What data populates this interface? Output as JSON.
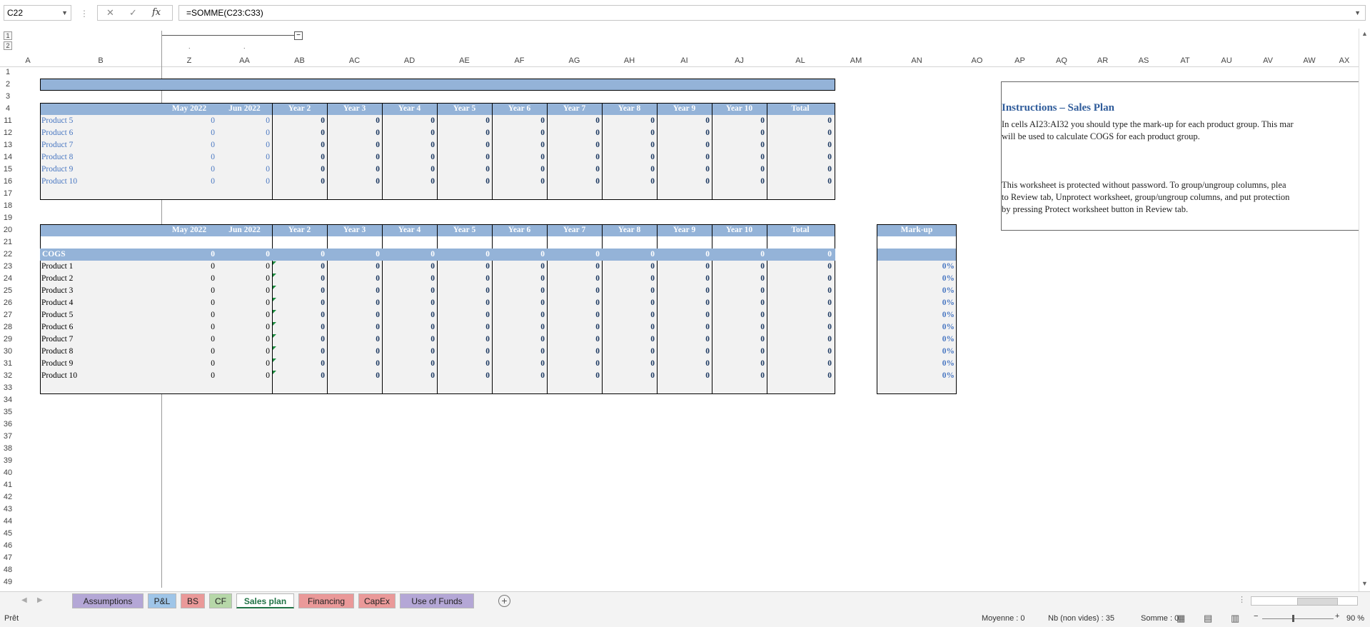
{
  "formula_bar": {
    "name_box": "C22",
    "cancel_icon": "✕",
    "enter_icon": "✓",
    "fx_label": "fx",
    "formula": "=SOMME(C23:C33)"
  },
  "outline": {
    "level1": "1",
    "level2": "2",
    "collapse": "−"
  },
  "columns": [
    "A",
    "B",
    "Z",
    "AA",
    "AB",
    "AC",
    "AD",
    "AE",
    "AF",
    "AG",
    "AH",
    "AI",
    "AJ",
    "AL",
    "AM",
    "AN",
    "AO",
    "AP",
    "AQ",
    "AR",
    "AS",
    "AT",
    "AU",
    "AV",
    "AW",
    "AX"
  ],
  "rows": [
    "1",
    "2",
    "3",
    "4",
    "11",
    "12",
    "13",
    "14",
    "15",
    "16",
    "17",
    "18",
    "19",
    "20",
    "21",
    "22",
    "23",
    "24",
    "25",
    "26",
    "27",
    "28",
    "29",
    "30",
    "31",
    "32",
    "33",
    "34",
    "35",
    "36",
    "37",
    "38",
    "39",
    "40",
    "41",
    "42",
    "43",
    "44",
    "45",
    "46",
    "47",
    "48",
    "49"
  ],
  "table1": {
    "headers": [
      "May 2022",
      "Jun 2022",
      "Year 2",
      "Year 3",
      "Year 4",
      "Year 5",
      "Year 6",
      "Year 7",
      "Year 8",
      "Year 9",
      "Year 10",
      "Total"
    ],
    "rows": [
      {
        "label": "Product 5",
        "values": [
          "0",
          "0",
          "0",
          "0",
          "0",
          "0",
          "0",
          "0",
          "0",
          "0",
          "0",
          "0"
        ]
      },
      {
        "label": "Product 6",
        "values": [
          "0",
          "0",
          "0",
          "0",
          "0",
          "0",
          "0",
          "0",
          "0",
          "0",
          "0",
          "0"
        ]
      },
      {
        "label": "Product 7",
        "values": [
          "0",
          "0",
          "0",
          "0",
          "0",
          "0",
          "0",
          "0",
          "0",
          "0",
          "0",
          "0"
        ]
      },
      {
        "label": "Product 8",
        "values": [
          "0",
          "0",
          "0",
          "0",
          "0",
          "0",
          "0",
          "0",
          "0",
          "0",
          "0",
          "0"
        ]
      },
      {
        "label": "Product 9",
        "values": [
          "0",
          "0",
          "0",
          "0",
          "0",
          "0",
          "0",
          "0",
          "0",
          "0",
          "0",
          "0"
        ]
      },
      {
        "label": "Product 10",
        "values": [
          "0",
          "0",
          "0",
          "0",
          "0",
          "0",
          "0",
          "0",
          "0",
          "0",
          "0",
          "0"
        ]
      }
    ]
  },
  "table2": {
    "headers": [
      "May 2022",
      "Jun 2022",
      "Year 2",
      "Year 3",
      "Year 4",
      "Year 5",
      "Year 6",
      "Year 7",
      "Year 8",
      "Year 9",
      "Year 10",
      "Total"
    ],
    "markup_header": "Mark-up",
    "cogs": {
      "label": "COGS",
      "values": [
        "0",
        "0",
        "0",
        "0",
        "0",
        "0",
        "0",
        "0",
        "0",
        "0",
        "0",
        "0"
      ]
    },
    "rows": [
      {
        "label": "Product 1",
        "values": [
          "0",
          "0",
          "0",
          "0",
          "0",
          "0",
          "0",
          "0",
          "0",
          "0",
          "0",
          "0"
        ],
        "markup": "0%"
      },
      {
        "label": "Product 2",
        "values": [
          "0",
          "0",
          "0",
          "0",
          "0",
          "0",
          "0",
          "0",
          "0",
          "0",
          "0",
          "0"
        ],
        "markup": "0%"
      },
      {
        "label": "Product 3",
        "values": [
          "0",
          "0",
          "0",
          "0",
          "0",
          "0",
          "0",
          "0",
          "0",
          "0",
          "0",
          "0"
        ],
        "markup": "0%"
      },
      {
        "label": "Product 4",
        "values": [
          "0",
          "0",
          "0",
          "0",
          "0",
          "0",
          "0",
          "0",
          "0",
          "0",
          "0",
          "0"
        ],
        "markup": "0%"
      },
      {
        "label": "Product 5",
        "values": [
          "0",
          "0",
          "0",
          "0",
          "0",
          "0",
          "0",
          "0",
          "0",
          "0",
          "0",
          "0"
        ],
        "markup": "0%"
      },
      {
        "label": "Product 6",
        "values": [
          "0",
          "0",
          "0",
          "0",
          "0",
          "0",
          "0",
          "0",
          "0",
          "0",
          "0",
          "0"
        ],
        "markup": "0%"
      },
      {
        "label": "Product 7",
        "values": [
          "0",
          "0",
          "0",
          "0",
          "0",
          "0",
          "0",
          "0",
          "0",
          "0",
          "0",
          "0"
        ],
        "markup": "0%"
      },
      {
        "label": "Product 8",
        "values": [
          "0",
          "0",
          "0",
          "0",
          "0",
          "0",
          "0",
          "0",
          "0",
          "0",
          "0",
          "0"
        ],
        "markup": "0%"
      },
      {
        "label": "Product 9",
        "values": [
          "0",
          "0",
          "0",
          "0",
          "0",
          "0",
          "0",
          "0",
          "0",
          "0",
          "0",
          "0"
        ],
        "markup": "0%"
      },
      {
        "label": "Product 10",
        "values": [
          "0",
          "0",
          "0",
          "0",
          "0",
          "0",
          "0",
          "0",
          "0",
          "0",
          "0",
          "0"
        ],
        "markup": "0%"
      }
    ]
  },
  "instructions": {
    "title": "Instructions – Sales Plan",
    "p1_line1": "In cells AI23:AI32 you should type the mark-up for each product group. This mar",
    "p1_line2": "will be used to calculate COGS for each product group.",
    "p2_line1": "This worksheet is protected without password. To group/ungroup columns, plea",
    "p2_line2": "to Review tab, Unprotect worksheet, group/ungroup columns, and put protection",
    "p2_line3": "by pressing Protect worksheet button in Review tab."
  },
  "sheet_tabs": [
    {
      "label": "Assumptions",
      "color": "#b4a7d6"
    },
    {
      "label": "P&L",
      "color": "#9fc5e8"
    },
    {
      "label": "BS",
      "color": "#ea9999"
    },
    {
      "label": "CF",
      "color": "#b6d7a8"
    },
    {
      "label": "Sales plan",
      "color": "#ffffff",
      "active": true
    },
    {
      "label": "Financing",
      "color": "#ea9999"
    },
    {
      "label": "CapEx",
      "color": "#ea9999"
    },
    {
      "label": "Use of Funds",
      "color": "#b4a7d6"
    }
  ],
  "status_bar": {
    "ready": "Prêt",
    "average": "Moyenne : 0",
    "count": "Nb (non vides) : 35",
    "sum": "Somme : 0",
    "zoom": "90 %"
  }
}
